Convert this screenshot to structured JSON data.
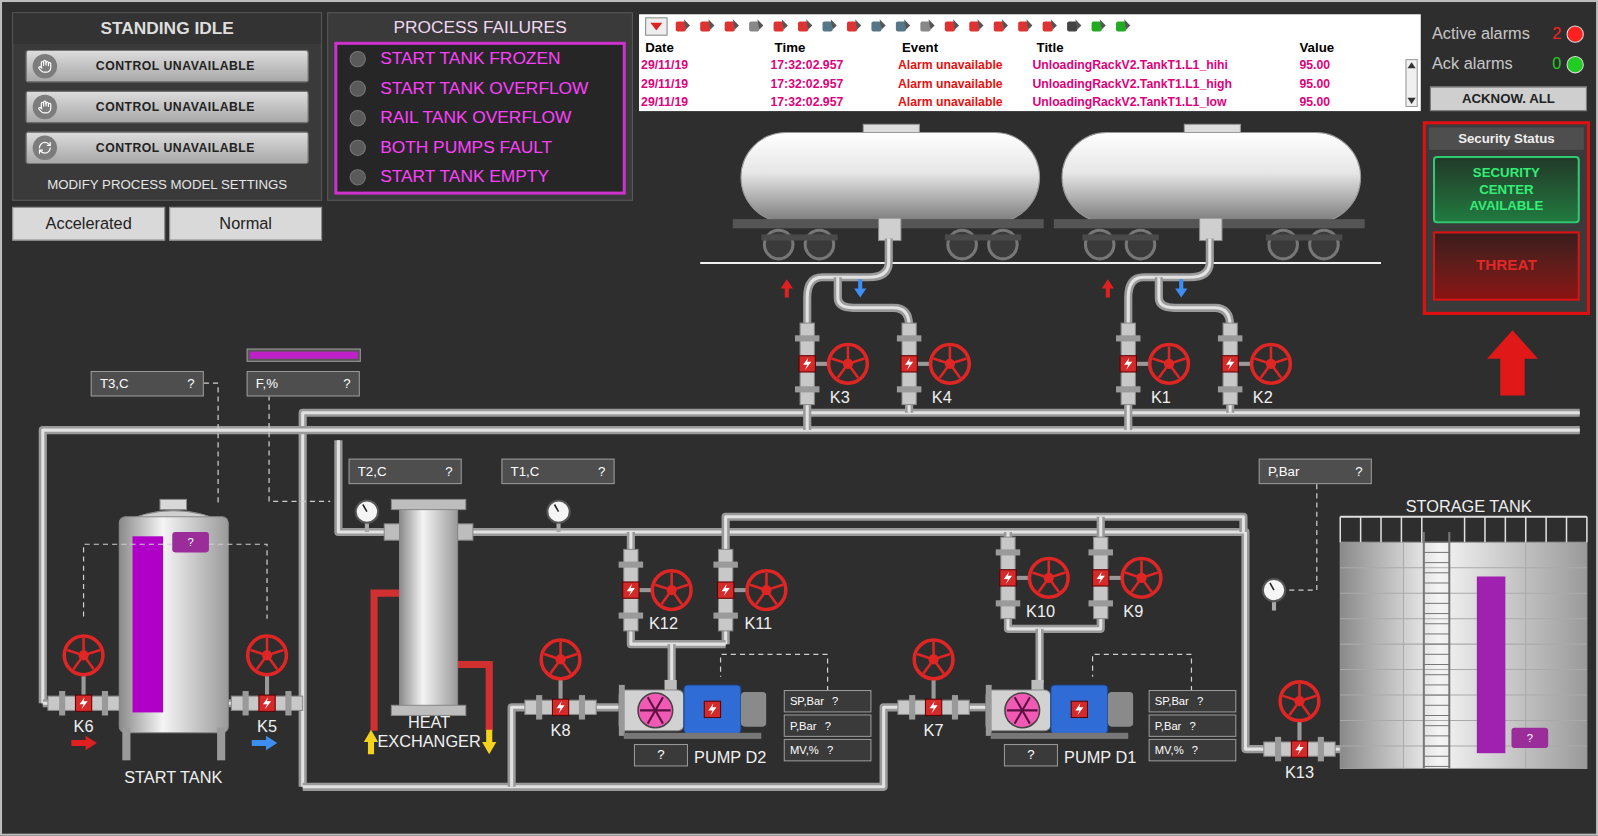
{
  "control_panel": {
    "title": "STANDING IDLE",
    "buttons": [
      {
        "label": "CONTROL UNAVAILABLE"
      },
      {
        "label": "CONTROL UNAVAILABLE"
      },
      {
        "label": "CONTROL UNAVAILABLE"
      }
    ],
    "settings_label": "MODIFY PROCESS MODEL SETTINGS"
  },
  "speed_modes": [
    {
      "label": "Accelerated",
      "selected": false
    },
    {
      "label": "Normal",
      "selected": false
    }
  ],
  "process_failures": {
    "title": "PROCESS FAILURES",
    "items": [
      {
        "label": "START TANK FROZEN",
        "active": false
      },
      {
        "label": "START TANK OVERFLOW",
        "active": false
      },
      {
        "label": "RAIL TANK OVERFLOW",
        "active": false
      },
      {
        "label": "BOTH PUMPS FAULT",
        "active": false
      },
      {
        "label": "START TANK EMPTY",
        "active": false
      }
    ]
  },
  "alarm_table": {
    "columns": [
      "Date",
      "Time",
      "Event",
      "Title",
      "Value"
    ],
    "rows": [
      {
        "date": "29/11/19",
        "time": "17:32:02.957",
        "event": "Alarm unavailable",
        "title": "UnloadingRackV2.TankT1.L1_hihi",
        "value": "95.00"
      },
      {
        "date": "29/11/19",
        "time": "17:32:02.957",
        "event": "Alarm unavailable",
        "title": "UnloadingRackV2.TankT1.L1_high",
        "value": "95.00"
      },
      {
        "date": "29/11/19",
        "time": "17:32:02.957",
        "event": "Alarm unavailable",
        "title": "UnloadingRackV2.TankT1.L1_low",
        "value": "95.00"
      }
    ]
  },
  "alarm_counters": [
    {
      "label": "Active alarms",
      "count": "2",
      "color": "#ff2020"
    },
    {
      "label": "Ack alarms",
      "count": "0",
      "color": "#22cc22"
    }
  ],
  "acknowledge_button": {
    "label": "ACKNOW. ALL"
  },
  "security_status": {
    "title": "Security Status",
    "center": "SECURITY CENTER AVAILABLE",
    "threat": "THREAT",
    "threat_active": true
  },
  "diagram": {
    "valves": [
      {
        "label": "K3",
        "kind": "side"
      },
      {
        "label": "K4",
        "kind": "side"
      },
      {
        "label": "K1",
        "kind": "side"
      },
      {
        "label": "K2",
        "kind": "side"
      },
      {
        "label": "K12",
        "kind": "side"
      },
      {
        "label": "K11",
        "kind": "side"
      },
      {
        "label": "K10",
        "kind": "side"
      },
      {
        "label": "K9",
        "kind": "side"
      },
      {
        "label": "K6",
        "kind": "top"
      },
      {
        "label": "K5",
        "kind": "top"
      },
      {
        "label": "K8",
        "kind": "top"
      },
      {
        "label": "K7",
        "kind": "top"
      },
      {
        "label": "K13",
        "kind": "top"
      }
    ],
    "sensors": [
      {
        "label": "T3,C",
        "value": "?"
      },
      {
        "label": "F,%",
        "value": "?"
      },
      {
        "label": "T2,C",
        "value": "?"
      },
      {
        "label": "T1,C",
        "value": "?"
      },
      {
        "label": "P,Bar",
        "value": "?"
      }
    ],
    "flow_bar": {
      "level": 1
    },
    "start_tank": {
      "label": "START TANK",
      "level": 0.9,
      "badge": "?"
    },
    "storage_tank": {
      "label": "STORAGE TANK",
      "level": 0.88,
      "badge": "?"
    },
    "heat_exchanger": {
      "label": "HEAT EXCHANGER"
    },
    "pumps": [
      {
        "label": "PUMP D2",
        "status": "?",
        "readings": [
          {
            "label": "SP,Bar",
            "value": "?"
          },
          {
            "label": "P,Bar",
            "value": "?"
          },
          {
            "label": "MV,%",
            "value": "?"
          }
        ]
      },
      {
        "label": "PUMP D1",
        "status": "?",
        "readings": [
          {
            "label": "SP,Bar",
            "value": "?"
          },
          {
            "label": "P,Bar",
            "value": "?"
          },
          {
            "label": "MV,%",
            "value": "?"
          }
        ]
      }
    ]
  }
}
